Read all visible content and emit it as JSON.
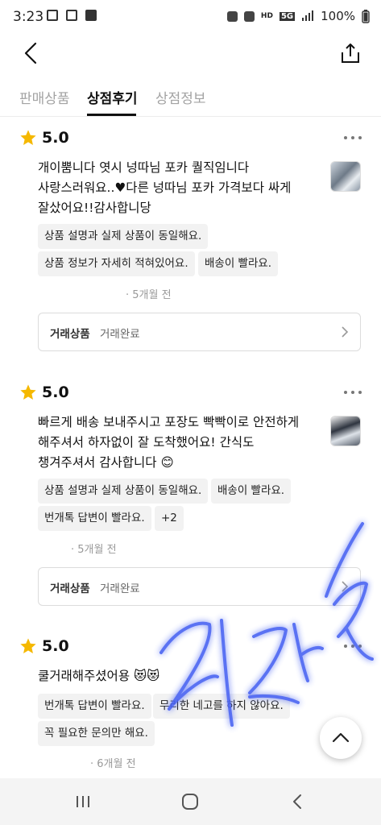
{
  "status_bar": {
    "time": "3:23",
    "battery": "100%",
    "network": "5G"
  },
  "tabs": [
    {
      "label": "판매상품",
      "active": false
    },
    {
      "label": "상점후기",
      "active": true
    },
    {
      "label": "상점정보",
      "active": false
    }
  ],
  "reviews": [
    {
      "rating": "5.0",
      "text_lines": [
        "개이뿜니다 엿시 넝따님 포카 퀄직임니다",
        "사랑스러워요..♥다른 넝따님 포카 가격보다 싸게",
        "잘샀어요!!감사합니당"
      ],
      "tags": [
        "상품 설명과 실제 상품이 동일해요.",
        "상품 정보가 자세히 적혀있어요.",
        "배송이 빨라요."
      ],
      "time": "· 5개월 전",
      "trade_label": "거래상품",
      "trade_status": "거래완료"
    },
    {
      "rating": "5.0",
      "text_lines": [
        "빠르게 배송 보내주시고 포장도 빡빡이로 안전하게",
        "해주셔서 하자없이 잘 도착했어요! 간식도",
        "챙겨주셔서 감사합니다 😊"
      ],
      "tags": [
        "상품 설명과 실제 상품이 동일해요.",
        "배송이 빨라요.",
        "번개톡 답변이 빨라요.",
        "+2"
      ],
      "time": "· 5개월 전",
      "trade_label": "거래상품",
      "trade_status": "거래완료"
    },
    {
      "rating": "5.0",
      "text_lines": [
        "쿨거래해주셨어용 😻😻"
      ],
      "tags": [
        "번개톡 답변이 빨라요.",
        "무리한 네고를 하지 않아요.",
        "꼭 필요한 문의만 해요."
      ],
      "time": "· 6개월 전"
    }
  ],
  "colors": {
    "star": "#f5b800",
    "active_tab": "#111111",
    "inactive_tab": "#a3a3a3",
    "chip_bg": "#f2f2f2",
    "signature": "#3a54f0"
  },
  "icons": [
    "back-arrow-icon",
    "share-icon",
    "star-icon",
    "more-icon",
    "chevron-right-icon",
    "chevron-up-icon",
    "recents-icon",
    "home-icon",
    "back-icon"
  ]
}
